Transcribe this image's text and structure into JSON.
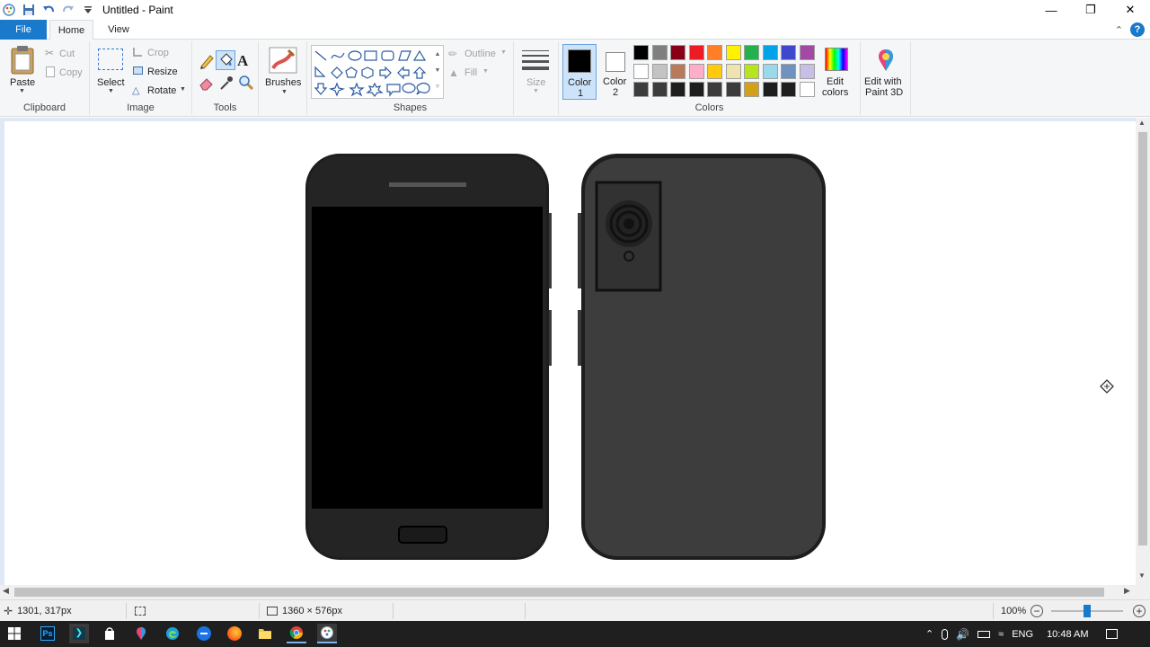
{
  "window": {
    "title": "Untitled - Paint"
  },
  "tabs": {
    "file": "File",
    "home": "Home",
    "view": "View"
  },
  "ribbon": {
    "clipboard": {
      "paste": "Paste",
      "cut": "Cut",
      "copy": "Copy",
      "group": "Clipboard"
    },
    "image": {
      "select": "Select",
      "crop": "Crop",
      "resize": "Resize",
      "rotate": "Rotate",
      "group": "Image"
    },
    "tools": {
      "group": "Tools"
    },
    "brushes": {
      "label": "Brushes"
    },
    "shapes": {
      "outline": "Outline",
      "fill": "Fill",
      "group": "Shapes"
    },
    "size": {
      "label": "Size"
    },
    "colors": {
      "color1": "Color",
      "color1_num": "1",
      "color2": "Color",
      "color2_num": "2",
      "edit_colors_1": "Edit",
      "edit_colors_2": "colors",
      "group": "Colors",
      "color1_value": "#000000",
      "color2_value": "#ffffff",
      "palette_row1": [
        "#000000",
        "#7f7f7f",
        "#880015",
        "#ed1c24",
        "#ff7f27",
        "#fff200",
        "#22b14c",
        "#00a2e8",
        "#3f48cc",
        "#a349a4"
      ],
      "palette_row2": [
        "#ffffff",
        "#c3c3c3",
        "#b97a57",
        "#ffaec9",
        "#ffc90e",
        "#efe4b0",
        "#b5e61d",
        "#99d9ea",
        "#7092be",
        "#c8bfe7"
      ],
      "palette_row3": [
        "#3c3c3c",
        "#3c3c3c",
        "#1e1e1e",
        "#1e1e1e",
        "#3c3c3c",
        "#3c3c3c",
        "#d4a017",
        "#1e1e1e",
        "#1e1e1e",
        "#ffffff"
      ]
    },
    "paint3d": {
      "line1": "Edit with",
      "line2": "Paint 3D"
    }
  },
  "status": {
    "cursor_pos": "1301, 317px",
    "image_size": "1360 × 576px",
    "zoom": "100%",
    "zoom_fraction": 0.5
  },
  "taskbar": {
    "lang": "ENG",
    "time": "10:48 AM"
  }
}
